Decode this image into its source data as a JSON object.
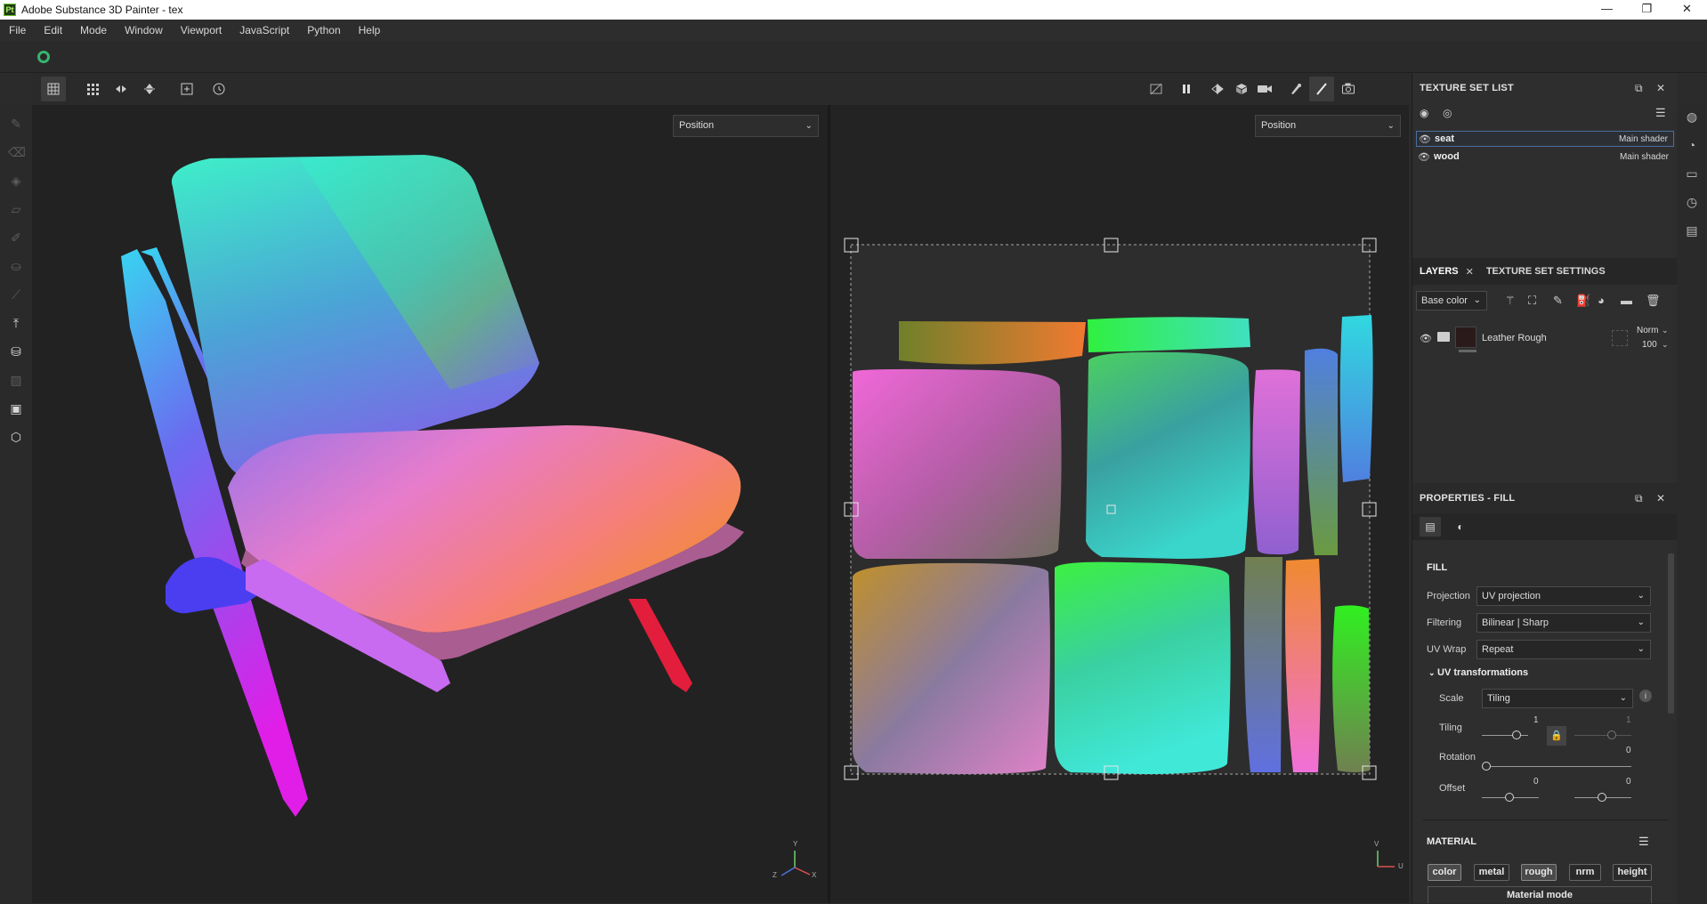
{
  "window": {
    "app_icon": "Pt",
    "title": "Adobe Substance 3D Painter - tex",
    "minimize": "—",
    "maximize": "❐",
    "close": "✕"
  },
  "menu": [
    "File",
    "Edit",
    "Mode",
    "Window",
    "Viewport",
    "JavaScript",
    "Python",
    "Help"
  ],
  "viewport3d": {
    "channel": "Position"
  },
  "viewport2d": {
    "channel": "Position"
  },
  "texture_set_list": {
    "title": "TEXTURE SET LIST",
    "items": [
      {
        "name": "seat",
        "shader": "Main shader",
        "selected": true
      },
      {
        "name": "wood",
        "shader": "Main shader",
        "selected": false
      }
    ]
  },
  "layers": {
    "tab_layers": "LAYERS",
    "tab_settings": "TEXTURE SET SETTINGS",
    "channel": "Base color",
    "layer": {
      "name": "Leather Rough",
      "blend": "Norm",
      "opacity": "100"
    }
  },
  "properties": {
    "title": "PROPERTIES - FILL",
    "section": "FILL",
    "projection_label": "Projection",
    "projection": "UV projection",
    "filtering_label": "Filtering",
    "filtering": "Bilinear | Sharp",
    "uvwrap_label": "UV Wrap",
    "uvwrap": "Repeat",
    "uvt_title": "UV transformations",
    "scale_label": "Scale",
    "scale": "Tiling",
    "tiling_label": "Tiling",
    "tiling_value": "1",
    "tiling_value2": "1",
    "rotation_label": "Rotation",
    "rotation_value": "0",
    "offset_label": "Offset",
    "offset_u": "0",
    "offset_v": "0"
  },
  "material": {
    "title": "MATERIAL",
    "buttons": [
      "color",
      "metal",
      "rough",
      "nrm",
      "height"
    ],
    "mode": "Material mode"
  },
  "axes": {
    "y": "Y",
    "x": "X",
    "z": "Z",
    "v": "V",
    "u": "U"
  },
  "colors": {
    "accent": "#4a6fa0",
    "sync_green": "#37b46f"
  }
}
